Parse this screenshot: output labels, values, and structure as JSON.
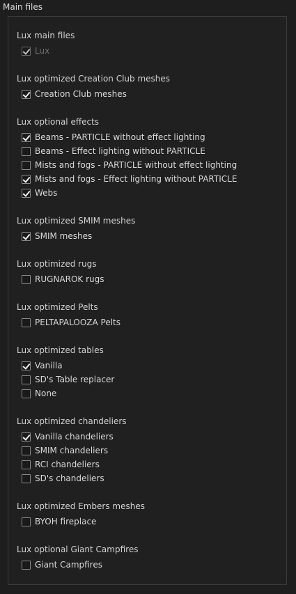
{
  "page": {
    "title": "Main files"
  },
  "sections": [
    {
      "title": "Lux main files",
      "options": [
        {
          "label": "Lux",
          "checked": true,
          "disabled": true
        }
      ]
    },
    {
      "title": "Lux optimized Creation Club meshes",
      "options": [
        {
          "label": "Creation Club meshes",
          "checked": true
        }
      ]
    },
    {
      "title": "Lux optional effects",
      "options": [
        {
          "label": "Beams - PARTICLE without effect lighting",
          "checked": true
        },
        {
          "label": "Beams - Effect lighting without PARTICLE",
          "checked": false
        },
        {
          "label": "Mists and fogs - PARTICLE without effect lighting",
          "checked": false
        },
        {
          "label": "Mists and fogs - Effect lighting without PARTICLE",
          "checked": true
        },
        {
          "label": "Webs",
          "checked": true
        }
      ]
    },
    {
      "title": "Lux optimized SMIM meshes",
      "options": [
        {
          "label": "SMIM meshes",
          "checked": true
        }
      ]
    },
    {
      "title": "Lux optimized rugs",
      "options": [
        {
          "label": "RUGNAROK rugs",
          "checked": false
        }
      ]
    },
    {
      "title": "Lux optimized Pelts",
      "options": [
        {
          "label": "PELTAPALOOZA Pelts",
          "checked": false
        }
      ]
    },
    {
      "title": "Lux optimized tables",
      "options": [
        {
          "label": "Vanilla",
          "checked": true
        },
        {
          "label": "SD's Table replacer",
          "checked": false
        },
        {
          "label": "None",
          "checked": false
        }
      ]
    },
    {
      "title": "Lux optimized chandeliers",
      "options": [
        {
          "label": "Vanilla chandeliers",
          "checked": true
        },
        {
          "label": "SMIM chandeliers",
          "checked": false
        },
        {
          "label": "RCI chandeliers",
          "checked": false
        },
        {
          "label": "SD's chandeliers",
          "checked": false
        }
      ]
    },
    {
      "title": "Lux optimized Embers meshes",
      "options": [
        {
          "label": "BYOH fireplace",
          "checked": false
        }
      ]
    },
    {
      "title": "Lux optional Giant Campfires",
      "options": [
        {
          "label": "Giant Campfires",
          "checked": false
        }
      ]
    }
  ]
}
